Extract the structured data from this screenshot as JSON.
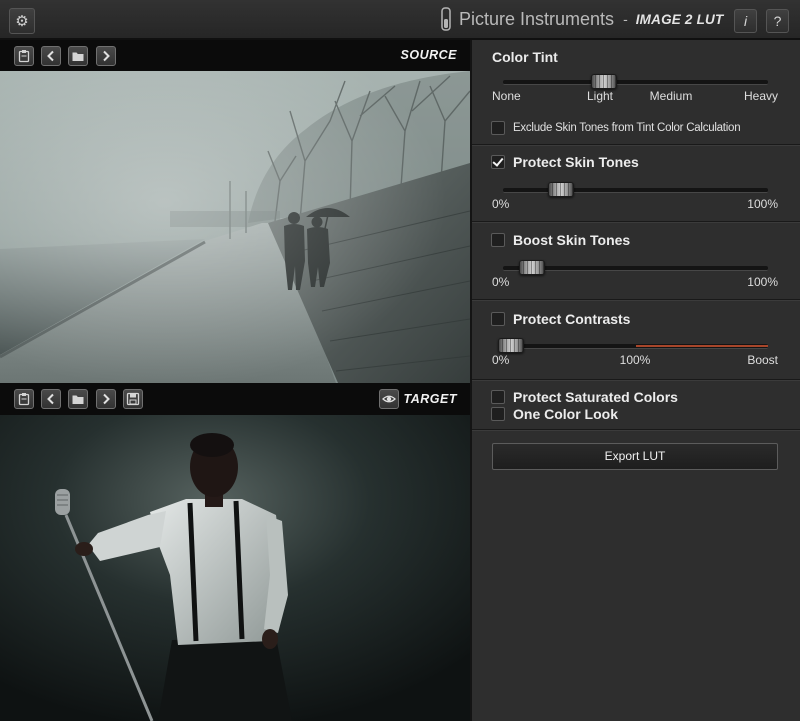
{
  "app": {
    "brand": "Picture Instruments",
    "separator": "-",
    "product": "IMAGE 2 LUT",
    "logo_icon": "test-tube-logo-icon",
    "settings_icon": "gear-icon",
    "info_label": "i",
    "help_label": "?"
  },
  "source": {
    "label": "SOURCE",
    "toolbar_icons": [
      "clipboard-icon",
      "chevron-left-icon",
      "folder-icon",
      "chevron-right-icon"
    ]
  },
  "target": {
    "label": "TARGET",
    "toolbar_icons": [
      "clipboard-icon",
      "chevron-left-icon",
      "folder-icon",
      "chevron-right-icon",
      "floppy-disk-icon"
    ],
    "view_icon": "eye-icon"
  },
  "panel": {
    "color_tint": {
      "heading": "Color Tint",
      "value": 0.38,
      "scale_labels": [
        "None",
        "Light",
        "Medium",
        "Heavy"
      ]
    },
    "exclude_skin_tones": {
      "label": "Exclude Skin Tones from Tint Color Calculation",
      "checked": false
    },
    "protect_skin_tones": {
      "label": "Protect Skin Tones",
      "checked": true,
      "value": 0.22,
      "min_label": "0%",
      "max_label": "100%"
    },
    "boost_skin_tones": {
      "label": "Boost Skin Tones",
      "checked": false,
      "value": 0.11,
      "min_label": "0%",
      "max_label": "100%"
    },
    "protect_contrasts": {
      "label": "Protect Contrasts",
      "checked": false,
      "value": 0.03,
      "min_label": "0%",
      "mid_label": "100%",
      "max_label": "Boost"
    },
    "protect_saturated_colors": {
      "label": "Protect Saturated Colors",
      "checked": false
    },
    "one_color_look": {
      "label": "One Color Look",
      "checked": false
    },
    "export_button": {
      "label": "Export LUT"
    }
  },
  "colors": {
    "panel_bg": "#2e2e2e",
    "boost_range": "#a8462a"
  }
}
